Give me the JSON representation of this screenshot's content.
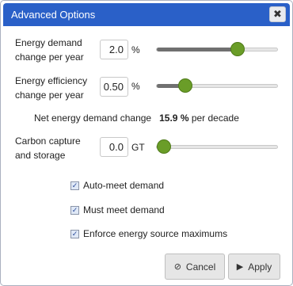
{
  "dialog": {
    "title": "Advanced Options",
    "close_icon": "close-icon",
    "close_glyph": "✖"
  },
  "demand": {
    "label_line1": "Energy demand",
    "label_line2": "change per year",
    "value": "2.0",
    "unit": "%",
    "slider_fraction": 0.67
  },
  "efficiency": {
    "label_line1": "Energy efficiency",
    "label_line2": "change per year",
    "value": "0.50",
    "unit": "%",
    "slider_fraction": 0.24
  },
  "net_change": {
    "prefix": "Net energy demand change",
    "value": "15.9 %",
    "suffix": "per decade"
  },
  "ccs": {
    "label_line1": "Carbon capture",
    "label_line2": "and storage",
    "value": "0.0",
    "unit": "GT",
    "slider_fraction": 0.0
  },
  "checkboxes": [
    {
      "label": "Auto-meet demand",
      "checked": true
    },
    {
      "label": "Must meet demand",
      "checked": true
    },
    {
      "label": "Enforce energy source maximums",
      "checked": true
    }
  ],
  "buttons": {
    "cancel_label": "Cancel",
    "cancel_icon": "cancel-icon",
    "cancel_glyph": "⊘",
    "apply_label": "Apply",
    "apply_icon": "play-icon",
    "apply_glyph": "▶"
  },
  "colors": {
    "titlebar": "#2a60c8",
    "slider_knob": "#6a9d28"
  }
}
